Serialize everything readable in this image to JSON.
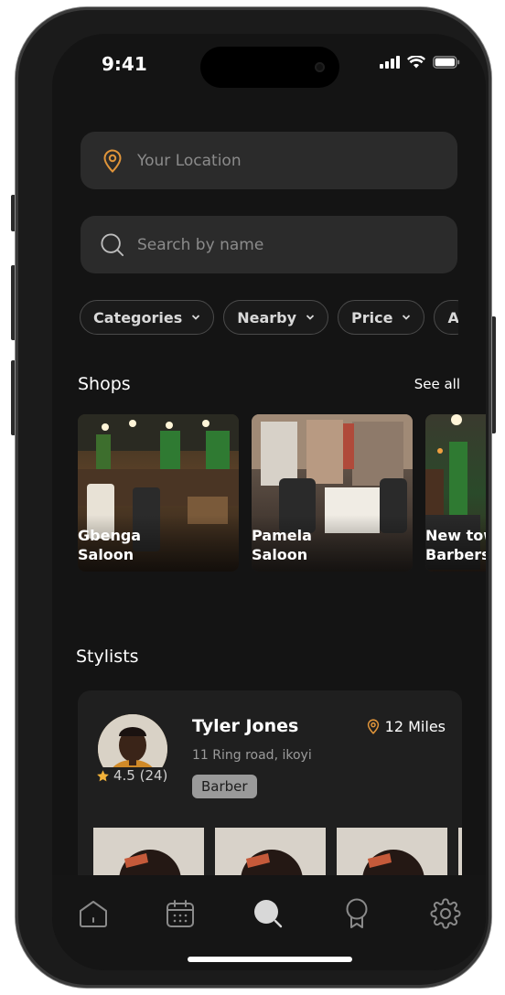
{
  "status": {
    "time": "9:41"
  },
  "location": {
    "placeholder": "Your Location"
  },
  "search": {
    "placeholder": "Search by name"
  },
  "filters": [
    "Categories",
    "Nearby",
    "Price",
    "A"
  ],
  "shops_section": {
    "title": "Shops",
    "see_all": "See all"
  },
  "shops": [
    {
      "name": "Gbenga\nSaloon"
    },
    {
      "name": "Pamela\nSaloon"
    },
    {
      "name": "New town\nBarbers"
    }
  ],
  "stylists_section": {
    "title": "Stylists"
  },
  "stylist": {
    "name": "Tyler Jones",
    "address": "11 Ring road, ikoyi",
    "distance": "12 Miles",
    "rating": "4.5 (24)",
    "tag": "Barber"
  },
  "colors": {
    "accent": "#e0953a",
    "background": "#141414",
    "card": "#2b2b2b"
  },
  "tabbar": [
    "home-icon",
    "calendar-icon",
    "search-icon",
    "award-icon",
    "settings-icon"
  ]
}
